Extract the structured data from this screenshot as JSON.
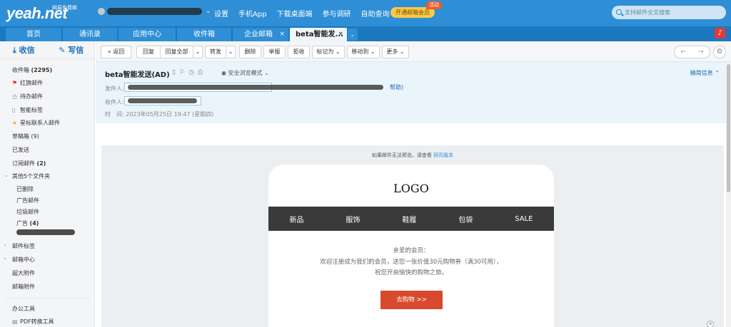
{
  "brand": {
    "logo": "yeah.net",
    "tagline": "网易免费邮"
  },
  "topnav": {
    "settings": "设置",
    "mobile_app": "手机App",
    "desktop": "下载桌面端",
    "survey": "参与调研",
    "self_query": "自助查询",
    "vip": "开通邮箱会员",
    "vip_badge": "活动",
    "search_placeholder": "支持邮件全文搜索"
  },
  "tabs": {
    "home": "首页",
    "contacts": "通讯录",
    "apps": "应用中心",
    "inbox": "收件箱",
    "enterprise": "企业邮箱",
    "current": "beta智能发...",
    "close": "×"
  },
  "sidebar": {
    "receive": "收信",
    "compose": "写信",
    "inbox": "收件箱",
    "inbox_count": "(2295)",
    "flagged": "红旗邮件",
    "todo": "待办邮件",
    "smart_tag": "智能标签",
    "star_contacts": "星标联系人邮件",
    "drafts": "草稿箱",
    "drafts_count": "(9)",
    "sent": "已发送",
    "subscriptions": "订阅邮件",
    "subscriptions_count": "(2)",
    "other_folders": "其他5个文件夹",
    "deleted": "已删除",
    "ads": "广告邮件",
    "spam": "垃圾邮件",
    "ad": "广告",
    "ad_count": "(4)",
    "mail_tags": "邮件标签",
    "mail_center": "邮箱中心",
    "large_attach": "超大附件",
    "mail_attach": "邮箱附件",
    "office_tools": "办公工具",
    "pdf_tool": "PDF转换工具"
  },
  "toolbar": {
    "back": "返回",
    "reply": "回复",
    "reply_all": "回复全部",
    "forward": "转发",
    "delete": "删除",
    "report": "举报",
    "reject": "拒收",
    "mark_as": "标记为",
    "move_to": "移动到",
    "more": "更多"
  },
  "email": {
    "subject": "beta智能发送(AD)",
    "safe_mode": "安全浏览模式",
    "brief": "精简信息",
    "from_label": "发件人:",
    "to_label": "收件人:",
    "help": "帮助)",
    "time_label": "时　间:",
    "time": "2023年05月25日 19:47 (星期四)"
  },
  "body": {
    "notice": "如果邮件无法预览，请查看",
    "notice_link": "网页版本",
    "logo": "LOGO",
    "nav": [
      "新品",
      "服饰",
      "鞋履",
      "包袋",
      "SALE"
    ],
    "greet1": "亲爱的会员：",
    "greet2": "欢迎注册成为我们的会员，送您一张价值30元购物券（满30可用），",
    "greet3": "祝您开启愉快的购物之旅。",
    "cta": "去购物 >>"
  }
}
